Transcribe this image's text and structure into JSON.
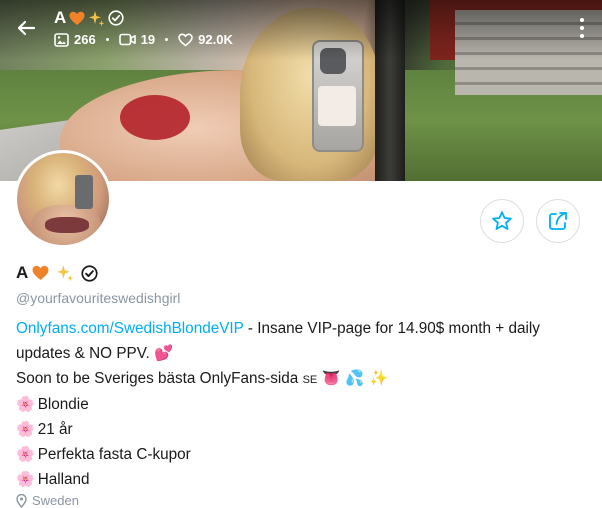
{
  "header": {
    "title": "A",
    "title_emojis": [
      "🧡",
      "✨"
    ],
    "stats": {
      "photos": "266",
      "videos": "19",
      "likes": "92.0K"
    }
  },
  "profile": {
    "name": "A",
    "name_emojis": [
      "🧡",
      "✨"
    ],
    "handle": "@yourfavouriteswedishgirl",
    "bio": {
      "link_text": "Onlyfans.com/SwedishBlondeVIP",
      "line1_rest": " - Insane VIP-page for 14.90$ month + daily updates & NO PPV.",
      "line1_emoji": "💕",
      "line2": "Soon to be Sveriges bästa OnlyFans-sida",
      "line2_flag": "SE",
      "line2_emojis": "👅 💦 ✨",
      "items": [
        "Blondie",
        "21 år",
        "Perfekta fasta C-kupor",
        "Halland"
      ],
      "item_emoji": "🌸"
    },
    "location": "Sweden"
  },
  "colors": {
    "accent": "#00aff0",
    "muted": "#8a96a3",
    "heart": "#f0832a"
  },
  "icons": [
    "back-arrow-icon",
    "image-icon",
    "video-icon",
    "heart-icon",
    "verified-icon",
    "more-vertical-icon",
    "star-icon",
    "share-icon",
    "location-pin-icon"
  ]
}
